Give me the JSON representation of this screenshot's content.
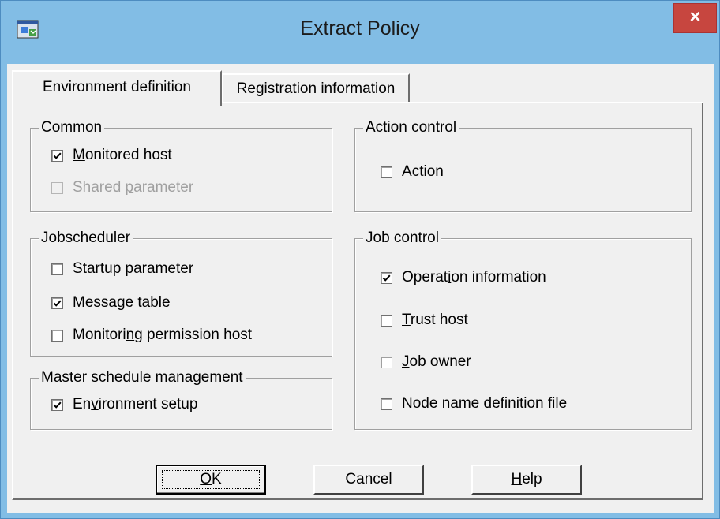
{
  "window": {
    "title": "Extract Policy",
    "close_label": "×"
  },
  "tabs": [
    {
      "label": "Environment definition",
      "active": true
    },
    {
      "label": "Registration information",
      "active": false
    }
  ],
  "groups": {
    "common": {
      "legend": "Common",
      "monitored_host": {
        "pre": "",
        "mn": "M",
        "post": "onitored host",
        "checked": true,
        "enabled": true
      },
      "shared_parameter": {
        "pre": "Shared ",
        "mn": "p",
        "post": "arameter",
        "checked": false,
        "enabled": false
      }
    },
    "action_control": {
      "legend": "Action control",
      "action": {
        "pre": "",
        "mn": "A",
        "post": "ction",
        "checked": false,
        "enabled": true
      }
    },
    "jobscheduler": {
      "legend": "Jobscheduler",
      "startup_parameter": {
        "pre": "",
        "mn": "S",
        "post": "tartup parameter",
        "checked": false,
        "enabled": true
      },
      "message_table": {
        "pre": "Me",
        "mn": "s",
        "post": "sage table",
        "checked": true,
        "enabled": true
      },
      "monitoring_permission_host": {
        "pre": "Monitori",
        "mn": "n",
        "post": "g permission host",
        "checked": false,
        "enabled": true
      }
    },
    "job_control": {
      "legend": "Job control",
      "operation_information": {
        "pre": "Operat",
        "mn": "i",
        "post": "on information",
        "checked": true,
        "enabled": true
      },
      "trust_host": {
        "pre": "",
        "mn": "T",
        "post": "rust host",
        "checked": false,
        "enabled": true
      },
      "job_owner": {
        "pre": "",
        "mn": "J",
        "post": "ob owner",
        "checked": false,
        "enabled": true
      },
      "node_name_definition_file": {
        "pre": "",
        "mn": "N",
        "post": "ode name definition file",
        "checked": false,
        "enabled": true
      }
    },
    "master_schedule": {
      "legend": "Master schedule management",
      "environment_setup": {
        "pre": "En",
        "mn": "v",
        "post": "ironment setup",
        "checked": true,
        "enabled": true
      }
    }
  },
  "buttons": {
    "ok": {
      "pre": "",
      "mn": "O",
      "post": "K"
    },
    "cancel": {
      "label": "Cancel"
    },
    "help": {
      "pre": "",
      "mn": "H",
      "post": "elp"
    }
  },
  "colors": {
    "title_bar": "#82bde5",
    "close_button": "#c7463f",
    "dialog_face": "#f0f0f0"
  }
}
